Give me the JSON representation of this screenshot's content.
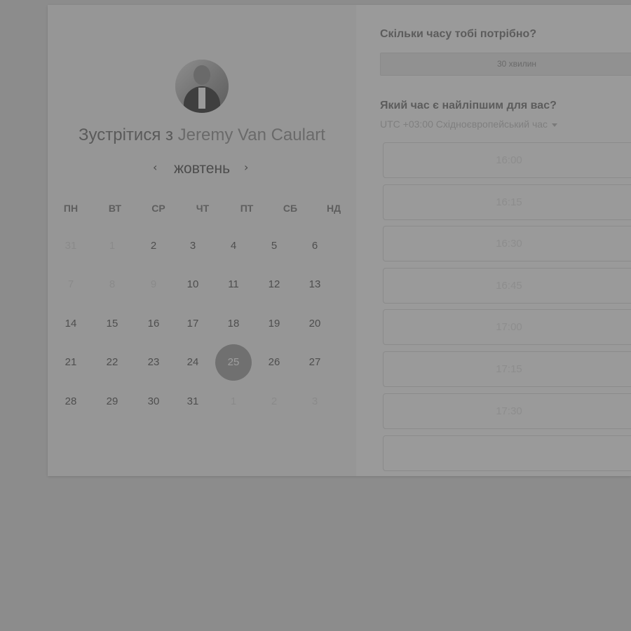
{
  "organizer": {
    "title_prefix": "Зустрітися з",
    "name": "Jeremy Van Caulart"
  },
  "calendar": {
    "month": "жовтень",
    "weekdays": [
      "ПН",
      "ВТ",
      "СР",
      "ЧТ",
      "ПТ",
      "СБ",
      "НД"
    ],
    "weeks": [
      [
        {
          "d": "31",
          "muted": true
        },
        {
          "d": "1",
          "muted": true
        },
        {
          "d": "2"
        },
        {
          "d": "3"
        },
        {
          "d": "4"
        },
        {
          "d": "5"
        },
        {
          "d": "6"
        }
      ],
      [
        {
          "d": "7",
          "muted": true
        },
        {
          "d": "8",
          "muted": true
        },
        {
          "d": "9",
          "muted": true
        },
        {
          "d": "10"
        },
        {
          "d": "11"
        },
        {
          "d": "12"
        },
        {
          "d": "13"
        }
      ],
      [
        {
          "d": "14"
        },
        {
          "d": "15"
        },
        {
          "d": "16"
        },
        {
          "d": "17"
        },
        {
          "d": "18"
        },
        {
          "d": "19"
        },
        {
          "d": "20"
        }
      ],
      [
        {
          "d": "21"
        },
        {
          "d": "22"
        },
        {
          "d": "23"
        },
        {
          "d": "24"
        },
        {
          "d": "25",
          "selected": true
        },
        {
          "d": "26"
        },
        {
          "d": "27"
        }
      ],
      [
        {
          "d": "28"
        },
        {
          "d": "29"
        },
        {
          "d": "30"
        },
        {
          "d": "31"
        },
        {
          "d": "1",
          "muted": true
        },
        {
          "d": "2",
          "muted": true
        },
        {
          "d": "3",
          "muted": true
        }
      ]
    ]
  },
  "duration": {
    "question": "Скільки часу тобі потрібно?",
    "selected": "30 хвилин"
  },
  "time": {
    "question": "Який час є найліпшим для вас?",
    "timezone": "UTC +03:00 Східноєвропейський час",
    "slots": [
      "16:00",
      "16:15",
      "16:30",
      "16:45",
      "17:00",
      "17:15",
      "17:30"
    ]
  },
  "colors": {
    "overlay": "#8c8c8c",
    "selected_day": "#707070"
  }
}
